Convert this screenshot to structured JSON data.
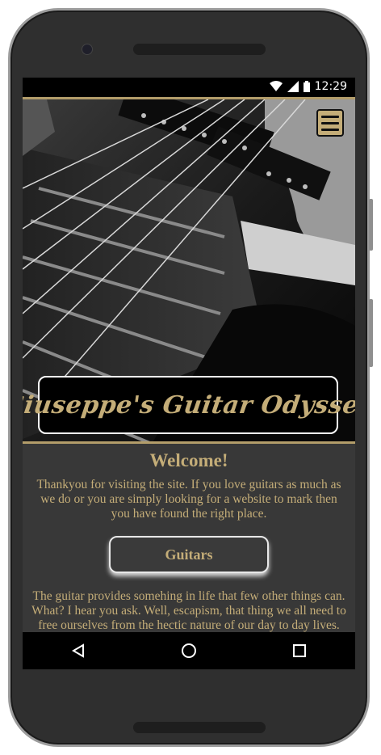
{
  "status_bar": {
    "time": "12:29",
    "icons": [
      "wifi-icon",
      "signal-icon",
      "battery-icon"
    ]
  },
  "header": {
    "menu_icon": "hamburger-menu-icon",
    "site_title": "Giuseppe's Guitar Odyssey"
  },
  "main": {
    "welcome_heading": "Welcome!",
    "intro_text": "Thankyou for visiting the site. If you love guitars as much as we do or you are simply looking for a website to mark then you have found the right place.",
    "guitars_button_label": "Guitars",
    "body_text": "The guitar provides somehing in life that few other things can. What? I hear you ask. Well, escapism, that thing we all need to free ourselves from the hectic nature of our day to day lives."
  },
  "nav_bar": {
    "items": [
      "back-icon",
      "home-icon",
      "recents-icon"
    ]
  },
  "colors": {
    "accent_gold": "#c4ad78",
    "background": "#383838",
    "bars": "#000000"
  }
}
